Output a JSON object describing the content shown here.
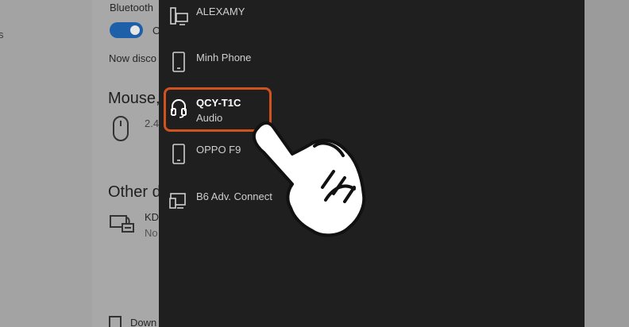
{
  "background": {
    "nav_text": "s",
    "bluetooth_label": "Bluetooth",
    "toggle_state": "O",
    "discoverable_text": "Now disco",
    "mouse_section": "Mouse,",
    "mouse_sub": "2.4",
    "other_section": "Other d",
    "other_device_name": "KD",
    "other_device_sub": "No",
    "download_text": "Down"
  },
  "flyout": {
    "devices": [
      {
        "name": "ALEXAMY",
        "sub": "",
        "icon": "desktop-phone-icon"
      },
      {
        "name": "Minh Phone",
        "sub": "",
        "icon": "phone-icon"
      },
      {
        "name": "QCY-T1C",
        "sub": "Audio",
        "icon": "headphones-icon",
        "selected": true
      },
      {
        "name": "OPPO F9",
        "sub": "",
        "icon": "phone-icon"
      },
      {
        "name": "B6 Adv. Connect",
        "sub": "",
        "icon": "display-phone-icon"
      }
    ]
  },
  "colors": {
    "flyout_bg": "#1f1f1f",
    "highlight": "#d0531f",
    "toggle_on": "#1d5fa8"
  }
}
